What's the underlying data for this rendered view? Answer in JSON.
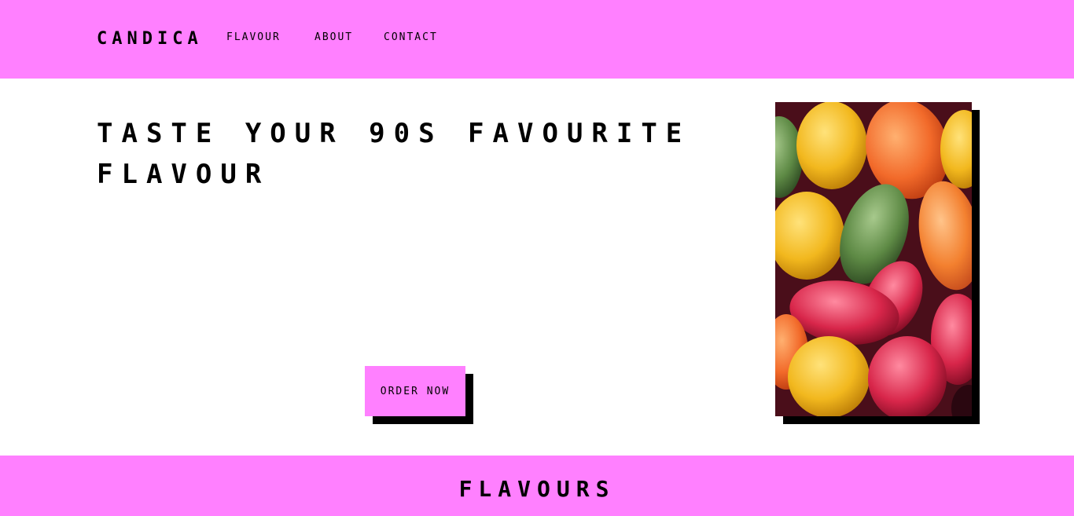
{
  "header": {
    "brand": "CANDICA",
    "nav": [
      {
        "label": "FLAVOUR"
      },
      {
        "label": "ABOUT"
      },
      {
        "label": "CONTACT"
      }
    ]
  },
  "hero": {
    "title": "TASTE YOUR 90S FAVOURITE FLAVOUR",
    "cta_label": "ORDER NOW"
  },
  "section": {
    "title": "FLAVOURS"
  },
  "colors": {
    "accent": "#ff80ff",
    "shadow": "#000000",
    "background": "#ffffff"
  }
}
